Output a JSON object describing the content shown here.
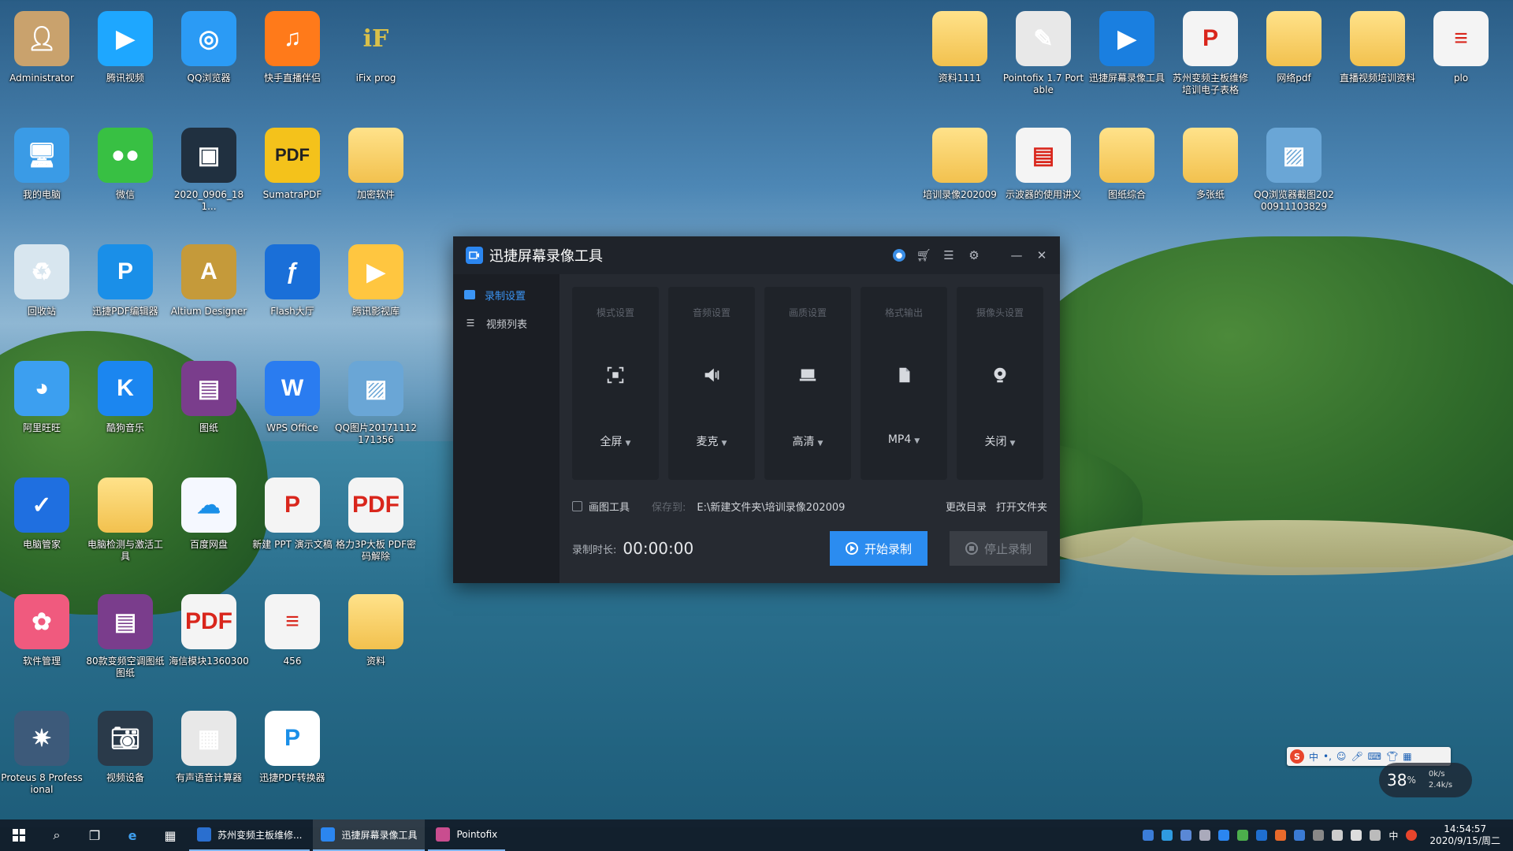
{
  "desktop": {
    "left_icons": [
      {
        "label": "Administrator",
        "icon": "user-avatar-icon"
      },
      {
        "label": "腾讯视频",
        "icon": "play-icon"
      },
      {
        "label": "QQ浏览器",
        "icon": "browser-icon"
      },
      {
        "label": "快手直播伴侣",
        "icon": "kuaishou-icon"
      },
      {
        "label": "iFix prog",
        "icon": "ifix-icon"
      },
      {
        "label": "我的电脑",
        "icon": "computer-icon"
      },
      {
        "label": "微信",
        "icon": "wechat-icon"
      },
      {
        "label": "2020_0906_181...",
        "icon": "video-file-icon"
      },
      {
        "label": "SumatraPDF",
        "icon": "pdf-reader-icon"
      },
      {
        "label": "加密软件",
        "icon": "folder-icon"
      },
      {
        "label": "回收站",
        "icon": "recycle-bin-icon"
      },
      {
        "label": "迅捷PDF编辑器",
        "icon": "pdf-editor-icon"
      },
      {
        "label": "Altium Designer",
        "icon": "altium-icon"
      },
      {
        "label": "Flash大厅",
        "icon": "flash-icon"
      },
      {
        "label": "腾讯影视库",
        "icon": "video-library-icon"
      },
      {
        "label": "阿里旺旺",
        "icon": "aliwangwang-icon"
      },
      {
        "label": "酷狗音乐",
        "icon": "kugou-icon"
      },
      {
        "label": "图纸",
        "icon": "archive-icon"
      },
      {
        "label": "WPS Office",
        "icon": "wps-icon"
      },
      {
        "label": "QQ图片20171112171356",
        "icon": "image-file-icon"
      },
      {
        "label": "电脑管家",
        "icon": "pc-manager-icon"
      },
      {
        "label": "电脑检测与激活工具",
        "icon": "folder-icon"
      },
      {
        "label": "百度网盘",
        "icon": "baidu-netdisk-icon"
      },
      {
        "label": "新建 PPT 演示文稿",
        "icon": "ppt-file-icon"
      },
      {
        "label": "格力3P大板 PDF密码解除",
        "icon": "pdf-file-icon"
      },
      {
        "label": "软件管理",
        "icon": "software-manager-icon"
      },
      {
        "label": "80款变频空调图纸图纸",
        "icon": "archive-icon"
      },
      {
        "label": "海信模块1360300",
        "icon": "pdf-file-icon"
      },
      {
        "label": "456",
        "icon": "doc-file-icon"
      },
      {
        "label": "资料",
        "icon": "folder-icon"
      },
      {
        "label": "Proteus 8 Professional",
        "icon": "proteus-icon"
      },
      {
        "label": "视频设备",
        "icon": "camera-icon"
      },
      {
        "label": "有声语音计算器",
        "icon": "calculator-icon"
      },
      {
        "label": "迅捷PDF转换器",
        "icon": "pdf-converter-icon"
      }
    ],
    "right_icons": [
      {
        "label": "资料1111",
        "icon": "folder-icon"
      },
      {
        "label": "Pointofix 1.7 Portable",
        "icon": "pointofix-icon"
      },
      {
        "label": "迅捷屏幕录像工具",
        "icon": "screen-recorder-icon"
      },
      {
        "label": "苏州变频主板维修培训电子表格",
        "icon": "ppt-file-icon"
      },
      {
        "label": "网络pdf",
        "icon": "pdf-folder-icon"
      },
      {
        "label": "直播视频培训资料",
        "icon": "folder-icon"
      },
      {
        "label": "plo",
        "icon": "doc-file-icon"
      },
      {
        "label": "培训录像202009",
        "icon": "folder-icon"
      },
      {
        "label": "示波器的使用讲义",
        "icon": "doc-image-icon"
      },
      {
        "label": "图纸综合",
        "icon": "pdf-folder-icon"
      },
      {
        "label": "多张纸",
        "icon": "pdf-folder-icon"
      },
      {
        "label": "QQ浏览器截图20200911103829",
        "icon": "image-file-icon"
      }
    ]
  },
  "window": {
    "title": "迅捷屏幕录像工具",
    "sidebar": [
      {
        "label": "录制设置",
        "active": true
      },
      {
        "label": "视频列表",
        "active": false
      }
    ],
    "cards": [
      {
        "title": "模式设置",
        "value": "全屏",
        "icon": "fullscreen-icon"
      },
      {
        "title": "音频设置",
        "value": "麦克",
        "icon": "speaker-icon"
      },
      {
        "title": "画质设置",
        "value": "高清",
        "icon": "monitor-icon"
      },
      {
        "title": "格式输出",
        "value": "MP4",
        "icon": "file-icon"
      },
      {
        "title": "摄像头设置",
        "value": "关闭",
        "icon": "webcam-icon"
      }
    ],
    "draw_tool_label": "画图工具",
    "save_to_label": "保存到:",
    "save_path": "E:\\新建文件夹\\培训录像202009",
    "change_dir_label": "更改目录",
    "open_folder_label": "打开文件夹",
    "duration_label": "录制时长:",
    "duration_value": "00:00:00",
    "start_label": "开始录制",
    "stop_label": "停止录制"
  },
  "taskbar": {
    "tasks": [
      {
        "label": "苏州变频主板维修...",
        "active": false,
        "color": "#2a6fcf"
      },
      {
        "label": "迅捷屏幕录像工具",
        "active": true,
        "color": "#2b86f0"
      },
      {
        "label": "Pointofix",
        "active": false,
        "color": "#c94d8f"
      }
    ],
    "ime_lang": "中",
    "time": "14:54:57",
    "date": "2020/9/15/周二"
  },
  "ime_bar": {
    "mode": "中"
  },
  "perf_widget": {
    "percent": "38",
    "unit": "%",
    "up": "0k/s",
    "down": "2.4k/s"
  },
  "colors": {
    "accent": "#2b8cf0",
    "window_bg": "#1e2228",
    "card_bg": "#1f2329"
  }
}
